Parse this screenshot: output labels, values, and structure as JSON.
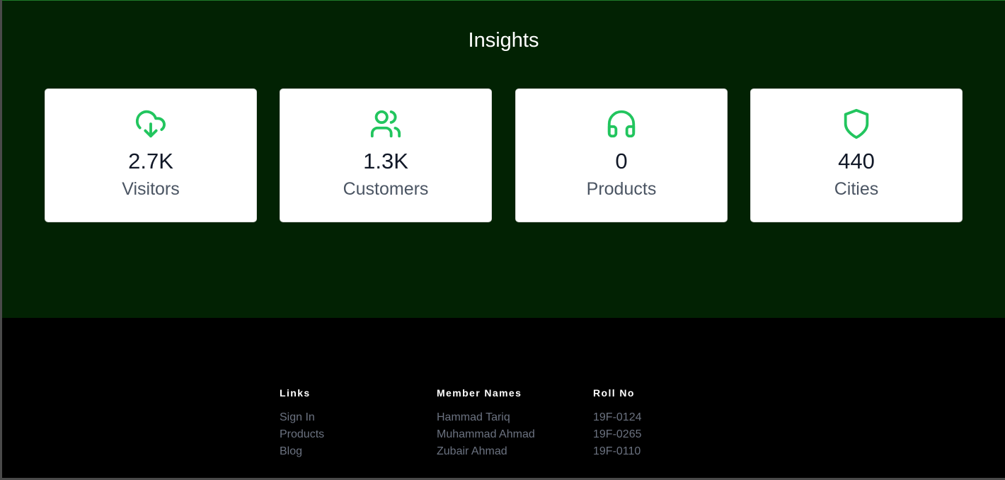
{
  "insights": {
    "title": "Insights",
    "accent_color": "#22c55e",
    "background_color": "#022203",
    "cards": [
      {
        "icon": "cloud-download-icon",
        "value": "2.7K",
        "label": "Visitors"
      },
      {
        "icon": "users-icon",
        "value": "1.3K",
        "label": "Customers"
      },
      {
        "icon": "headphones-icon",
        "value": "0",
        "label": "Products"
      },
      {
        "icon": "shield-icon",
        "value": "440",
        "label": "Cities"
      }
    ]
  },
  "footer": {
    "links": {
      "heading": "Links",
      "items": [
        "Sign In",
        "Products",
        "Blog"
      ]
    },
    "members": {
      "heading": "Member Names",
      "items": [
        "Hammad Tariq",
        "Muhammad Ahmad",
        "Zubair Ahmad"
      ]
    },
    "rolls": {
      "heading": "Roll No",
      "items": [
        "19F-0124",
        "19F-0265",
        "19F-0110"
      ]
    }
  }
}
